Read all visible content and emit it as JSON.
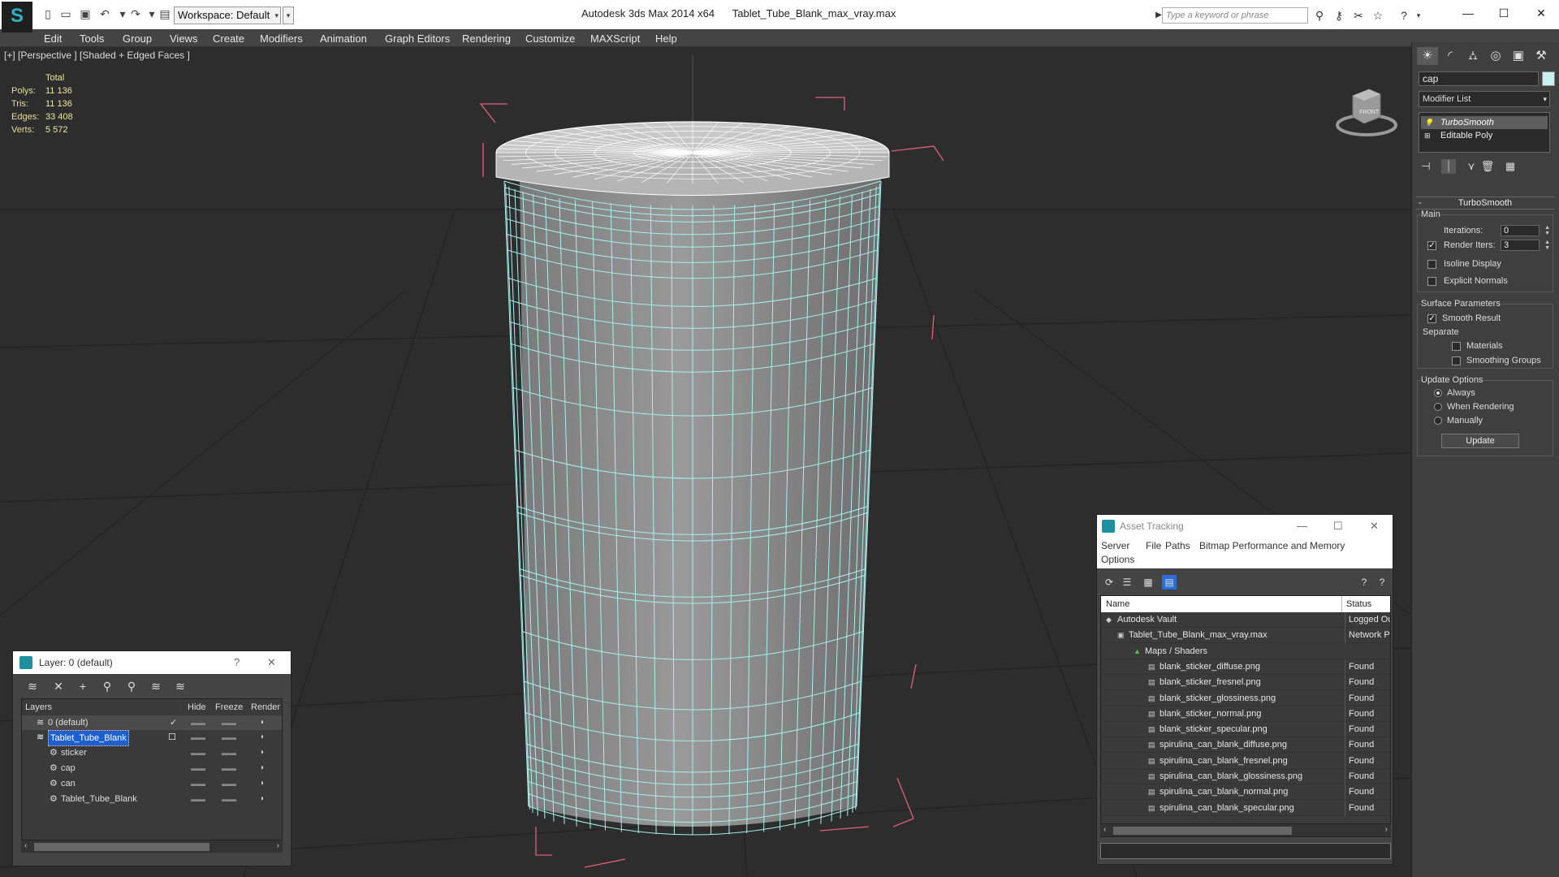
{
  "titlebar": {
    "workspace_label": "Workspace: Default",
    "app_name": "Autodesk 3ds Max  2014 x64",
    "file_name": "Tablet_Tube_Blank_max_vray.max",
    "search_placeholder": "Type a keyword or phrase"
  },
  "menu": [
    "Edit",
    "Tools",
    "Group",
    "Views",
    "Create",
    "Modifiers",
    "Animation",
    "Graph Editors",
    "Rendering",
    "Customize",
    "MAXScript",
    "Help"
  ],
  "viewport": {
    "label": "[+] [Perspective ] [Shaded + Edged Faces ]",
    "stats": {
      "total_label": "Total",
      "rows": [
        {
          "label": "Polys:",
          "value": "11 136"
        },
        {
          "label": "Tris:",
          "value": "11 136"
        },
        {
          "label": "Edges:",
          "value": "33 408"
        },
        {
          "label": "Verts:",
          "value": "5 572"
        }
      ]
    },
    "viewcube_label": "FRONT"
  },
  "command_panel": {
    "object_name": "cap",
    "modifier_list_label": "Modifier List",
    "stack": [
      "TurboSmooth",
      "Editable Poly"
    ],
    "rollout_title": "TurboSmooth",
    "main_group": "Main",
    "iterations_label": "Iterations:",
    "iterations_value": "0",
    "render_iters_label": "Render Iters:",
    "render_iters_value": "3",
    "isoline_label": "Isoline Display",
    "explicit_normals_label": "Explicit Normals",
    "surface_group": "Surface Parameters",
    "smooth_result_label": "Smooth Result",
    "separate_label": "Separate",
    "materials_label": "Materials",
    "smoothing_groups_label": "Smoothing Groups",
    "update_group": "Update Options",
    "always_label": "Always",
    "when_rendering_label": "When Rendering",
    "manually_label": "Manually",
    "update_button": "Update"
  },
  "layer_dialog": {
    "title": "Layer: 0 (default)",
    "help": "?",
    "columns": [
      "Layers",
      "Hide",
      "Freeze",
      "Render"
    ],
    "rows": [
      {
        "name": "0 (default)",
        "indent": 0
      },
      {
        "name": "Tablet_Tube_Blank",
        "indent": 0
      },
      {
        "name": "sticker",
        "indent": 1
      },
      {
        "name": "cap",
        "indent": 1
      },
      {
        "name": "can",
        "indent": 1
      },
      {
        "name": "Tablet_Tube_Blank",
        "indent": 1
      }
    ]
  },
  "asset_dialog": {
    "title": "Asset Tracking",
    "menu": [
      "Server",
      "File",
      "Paths",
      "Bitmap Performance and Memory",
      "Options"
    ],
    "columns": [
      "Name",
      "Status"
    ],
    "rows": [
      {
        "name": "Autodesk Vault",
        "status": "Logged Out",
        "indent": 0
      },
      {
        "name": "Tablet_Tube_Blank_max_vray.max",
        "status": "Network Path",
        "indent": 1
      },
      {
        "name": "Maps / Shaders",
        "status": "",
        "indent": 2
      },
      {
        "name": "blank_sticker_diffuse.png",
        "status": "Found",
        "indent": 3
      },
      {
        "name": "blank_sticker_fresnel.png",
        "status": "Found",
        "indent": 3
      },
      {
        "name": "blank_sticker_glossiness.png",
        "status": "Found",
        "indent": 3
      },
      {
        "name": "blank_sticker_normal.png",
        "status": "Found",
        "indent": 3
      },
      {
        "name": "blank_sticker_specular.png",
        "status": "Found",
        "indent": 3
      },
      {
        "name": "spirulina_can_blank_diffuse.png",
        "status": "Found",
        "indent": 3
      },
      {
        "name": "spirulina_can_blank_fresnel.png",
        "status": "Found",
        "indent": 3
      },
      {
        "name": "spirulina_can_blank_glossiness.png",
        "status": "Found",
        "indent": 3
      },
      {
        "name": "spirulina_can_blank_normal.png",
        "status": "Found",
        "indent": 3
      },
      {
        "name": "spirulina_can_blank_specular.png",
        "status": "Found",
        "indent": 3
      }
    ]
  },
  "colors": {
    "wire": "#a8f0f0",
    "cap_wire": "#ffffff",
    "bbox": "#e0607a",
    "mesh": "#8a8a8a",
    "grid": "#222222"
  }
}
